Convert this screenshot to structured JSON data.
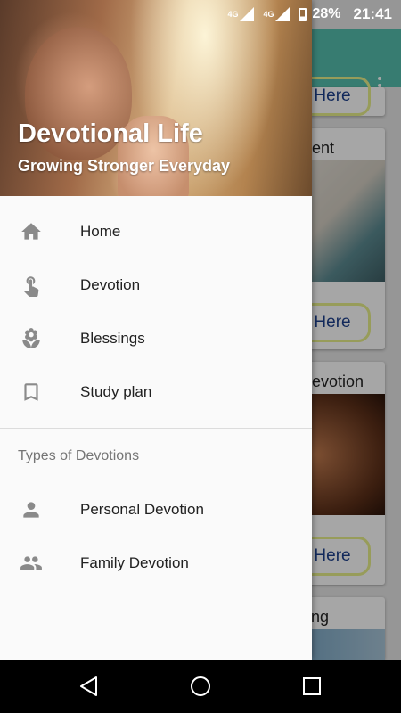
{
  "status_bar": {
    "network1": "4G",
    "network2": "4G",
    "battery": "28%",
    "time": "21:41"
  },
  "drawer": {
    "header": {
      "title": "Devotional Life",
      "subtitle": "Growing Stronger Everyday"
    },
    "items": [
      {
        "label": "Home",
        "icon": "home-icon"
      },
      {
        "label": "Devotion",
        "icon": "touch-icon"
      },
      {
        "label": "Blessings",
        "icon": "flower-icon"
      },
      {
        "label": "Study plan",
        "icon": "bookmark-icon"
      }
    ],
    "section_title": "Types of Devotions",
    "section_items": [
      {
        "label": "Personal Devotion",
        "icon": "person-icon"
      },
      {
        "label": "Family Devotion",
        "icon": "people-icon"
      }
    ]
  },
  "background": {
    "cards": [
      {
        "title": "",
        "button": "Here"
      },
      {
        "title": "gent",
        "button": "Here"
      },
      {
        "title": "evotion",
        "button": "Here"
      },
      {
        "title": "ing",
        "button": ""
      }
    ]
  },
  "colors": {
    "accent": "#55bfae",
    "icon_gray": "#8a8a8a"
  }
}
